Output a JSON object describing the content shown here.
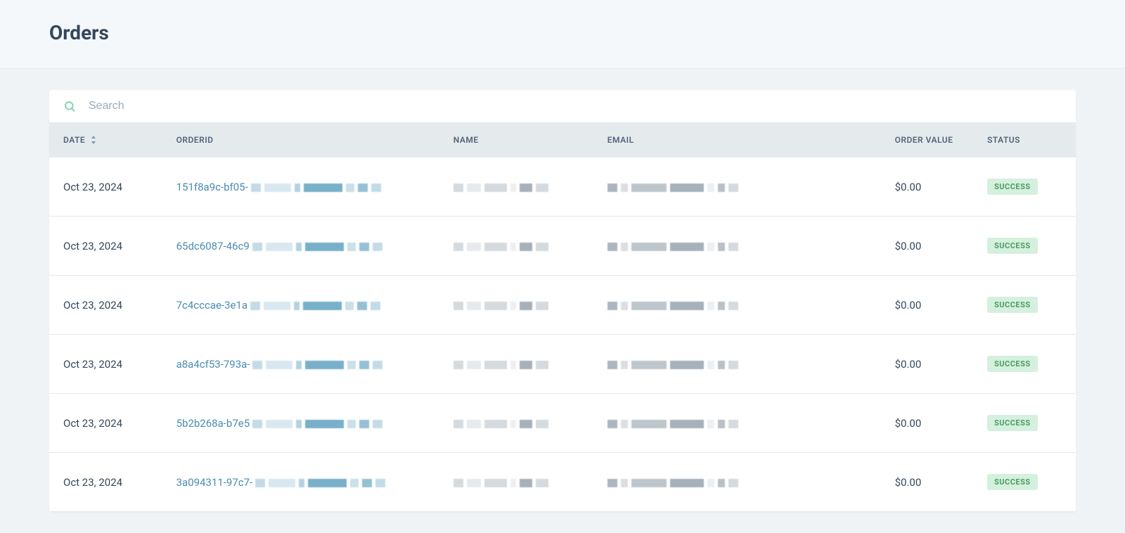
{
  "page": {
    "title": "Orders"
  },
  "search": {
    "placeholder": "Search",
    "value": ""
  },
  "table": {
    "columns": {
      "date": "DATE",
      "orderid": "ORDERID",
      "name": "NAME",
      "email": "EMAIL",
      "order_value": "ORDER VALUE",
      "status": "STATUS"
    },
    "rows": [
      {
        "date": "Oct 23, 2024",
        "order_id_prefix": "151f8a9c-bf05-",
        "order_value": "$0.00",
        "status": "SUCCESS"
      },
      {
        "date": "Oct 23, 2024",
        "order_id_prefix": "65dc6087-46c9",
        "order_value": "$0.00",
        "status": "SUCCESS"
      },
      {
        "date": "Oct 23, 2024",
        "order_id_prefix": "7c4cccae-3e1a",
        "order_value": "$0.00",
        "status": "SUCCESS"
      },
      {
        "date": "Oct 23, 2024",
        "order_id_prefix": "a8a4cf53-793a-",
        "order_value": "$0.00",
        "status": "SUCCESS"
      },
      {
        "date": "Oct 23, 2024",
        "order_id_prefix": "5b2b268a-b7e5",
        "order_value": "$0.00",
        "status": "SUCCESS"
      },
      {
        "date": "Oct 23, 2024",
        "order_id_prefix": "3a094311-97c7-",
        "order_value": "$0.00",
        "status": "SUCCESS"
      }
    ]
  }
}
